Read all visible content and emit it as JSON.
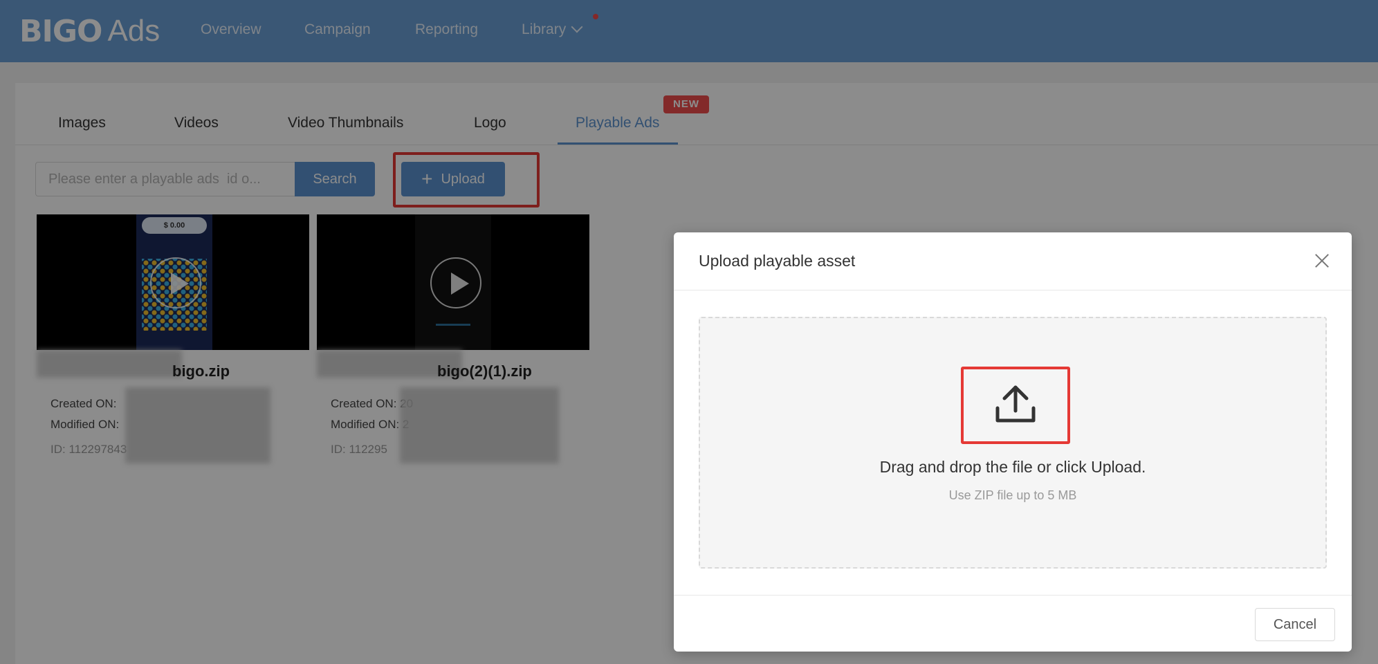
{
  "brand": {
    "logo_bigo": "BIGO",
    "logo_ads": "Ads"
  },
  "nav": {
    "items": [
      {
        "label": "Overview"
      },
      {
        "label": "Campaign"
      },
      {
        "label": "Reporting"
      },
      {
        "label": "Library"
      }
    ]
  },
  "tabs": {
    "items": [
      {
        "label": "Images"
      },
      {
        "label": "Videos"
      },
      {
        "label": "Video Thumbnails"
      },
      {
        "label": "Logo"
      },
      {
        "label": "Playable Ads"
      }
    ],
    "active": "Playable Ads",
    "new_badge": "NEW"
  },
  "toolbar": {
    "search_placeholder": "Please enter a playable ads  id o...",
    "search_label": "Search",
    "upload_label": "Upload"
  },
  "cards": [
    {
      "title": "bigo.zip",
      "created_label": "Created ON:",
      "modified_label": "Modified ON:",
      "id_label": "ID: 112297843"
    },
    {
      "title": "bigo(2)(1).zip",
      "created_label": "Created ON: 20",
      "modified_label": "Modified ON: 2",
      "id_label": "ID: 112295"
    }
  ],
  "thumb_banner": {
    "amount": "$ 0.00"
  },
  "modal": {
    "title": "Upload playable asset",
    "drop_main": "Drag and drop the file or click Upload.",
    "drop_sub": "Use ZIP file up to 5 MB",
    "cancel_label": "Cancel"
  },
  "colors": {
    "primary": "#5b93cf",
    "nav_bg": "#6a9fd5",
    "highlight": "#e53935",
    "badge": "#ee4d4d"
  },
  "icons": [
    "close-icon",
    "upload-icon",
    "play-icon",
    "plus-icon",
    "chevron-down-icon"
  ]
}
